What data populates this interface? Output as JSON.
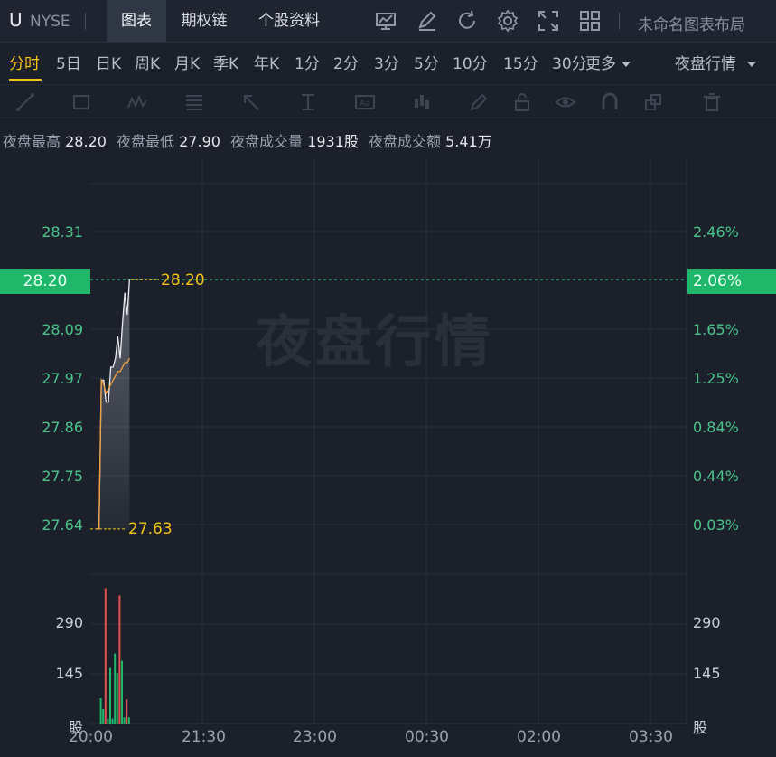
{
  "header": {
    "ticker": "U",
    "exchange": "NYSE",
    "tabs": [
      "图表",
      "期权链",
      "个股资料"
    ],
    "active_tab": "图表",
    "icons": [
      "chart-type-icon",
      "draw-icon",
      "refresh-icon",
      "settings-icon",
      "fullscreen-icon",
      "layout-grid-icon"
    ],
    "layout_label": "未命名图表布局"
  },
  "periods": {
    "items": [
      "分时",
      "5日",
      "日K",
      "周K",
      "月K",
      "季K",
      "年K",
      "1分",
      "2分",
      "3分",
      "5分",
      "10分",
      "15分",
      "30分"
    ],
    "more_label": "更多",
    "active": "分时",
    "session_selector": "夜盘行情"
  },
  "drawing_tools": [
    "line-tool-icon",
    "rectangle-tool-icon",
    "pattern-tool-icon",
    "fibonacci-tool-icon",
    "arrow-tool-icon",
    "measure-tool-icon",
    "text-tool-icon",
    "indicator-tool-icon",
    "pen-tool-icon",
    "lock-icon",
    "eye-icon",
    "magnet-icon",
    "copy-icon",
    "trash-icon"
  ],
  "info": {
    "high_label": "夜盘最高",
    "high": "28.20",
    "low_label": "夜盘最低",
    "low": "27.90",
    "volume_label": "夜盘成交量",
    "volume": "1931股",
    "amount_label": "夜盘成交额",
    "amount": "5.41万"
  },
  "chart_data": {
    "type": "line",
    "watermark": "夜盘行情",
    "price_axis_left": [
      "28.31",
      "28.20",
      "28.09",
      "27.97",
      "27.86",
      "27.75",
      "27.64"
    ],
    "price_axis_right": [
      "2.46%",
      "2.06%",
      "1.65%",
      "1.25%",
      "0.84%",
      "0.44%",
      "0.03%"
    ],
    "current_price": "28.20",
    "current_pct": "2.06%",
    "high_marker": "28.20",
    "low_marker": "27.63",
    "volume_axis": [
      "290",
      "145",
      "股"
    ],
    "time_axis": [
      "20:00",
      "21:30",
      "23:00",
      "00:30",
      "02:00",
      "03:30"
    ],
    "ylim": [
      27.63,
      28.31
    ],
    "price_series": [
      {
        "t": 0,
        "p": 27.63
      },
      {
        "t": 1,
        "p": 27.63
      },
      {
        "t": 2,
        "p": 27.97
      },
      {
        "t": 3,
        "p": 27.97
      },
      {
        "t": 4,
        "p": 27.92
      },
      {
        "t": 5,
        "p": 27.92
      },
      {
        "t": 6,
        "p": 28.0
      },
      {
        "t": 7,
        "p": 28.0
      },
      {
        "t": 8,
        "p": 28.02
      },
      {
        "t": 9,
        "p": 28.07
      },
      {
        "t": 10,
        "p": 28.02
      },
      {
        "t": 11,
        "p": 28.1
      },
      {
        "t": 12,
        "p": 28.17
      },
      {
        "t": 13,
        "p": 28.12
      },
      {
        "t": 14,
        "p": 28.2
      }
    ],
    "avg_series": [
      {
        "t": 0,
        "p": 27.63
      },
      {
        "t": 1,
        "p": 27.63
      },
      {
        "t": 2,
        "p": 27.97
      },
      {
        "t": 3,
        "p": 27.96
      },
      {
        "t": 4,
        "p": 27.94
      },
      {
        "t": 5,
        "p": 27.95
      },
      {
        "t": 6,
        "p": 27.96
      },
      {
        "t": 7,
        "p": 27.97
      },
      {
        "t": 8,
        "p": 27.98
      },
      {
        "t": 9,
        "p": 27.99
      },
      {
        "t": 10,
        "p": 27.99
      },
      {
        "t": 11,
        "p": 28.0
      },
      {
        "t": 12,
        "p": 28.01
      },
      {
        "t": 13,
        "p": 28.01
      },
      {
        "t": 14,
        "p": 28.02
      }
    ],
    "volume_series": [
      {
        "t": 1,
        "v": 105,
        "dir": "up"
      },
      {
        "t": 2,
        "v": 60,
        "dir": "up"
      },
      {
        "t": 3,
        "v": 560,
        "dir": "down"
      },
      {
        "t": 4,
        "v": 20,
        "dir": "up"
      },
      {
        "t": 5,
        "v": 230,
        "dir": "up"
      },
      {
        "t": 6,
        "v": 20,
        "dir": "up"
      },
      {
        "t": 7,
        "v": 290,
        "dir": "up"
      },
      {
        "t": 8,
        "v": 210,
        "dir": "up"
      },
      {
        "t": 9,
        "v": 530,
        "dir": "down"
      },
      {
        "t": 10,
        "v": 260,
        "dir": "up"
      },
      {
        "t": 11,
        "v": 25,
        "dir": "up"
      },
      {
        "t": 12,
        "v": 100,
        "dir": "down"
      },
      {
        "t": 13,
        "v": 25,
        "dir": "up"
      }
    ],
    "colors": {
      "up": "#1fb86b",
      "down": "#e0524f",
      "price": "#e9ebf0",
      "avg": "#f0a040"
    }
  }
}
